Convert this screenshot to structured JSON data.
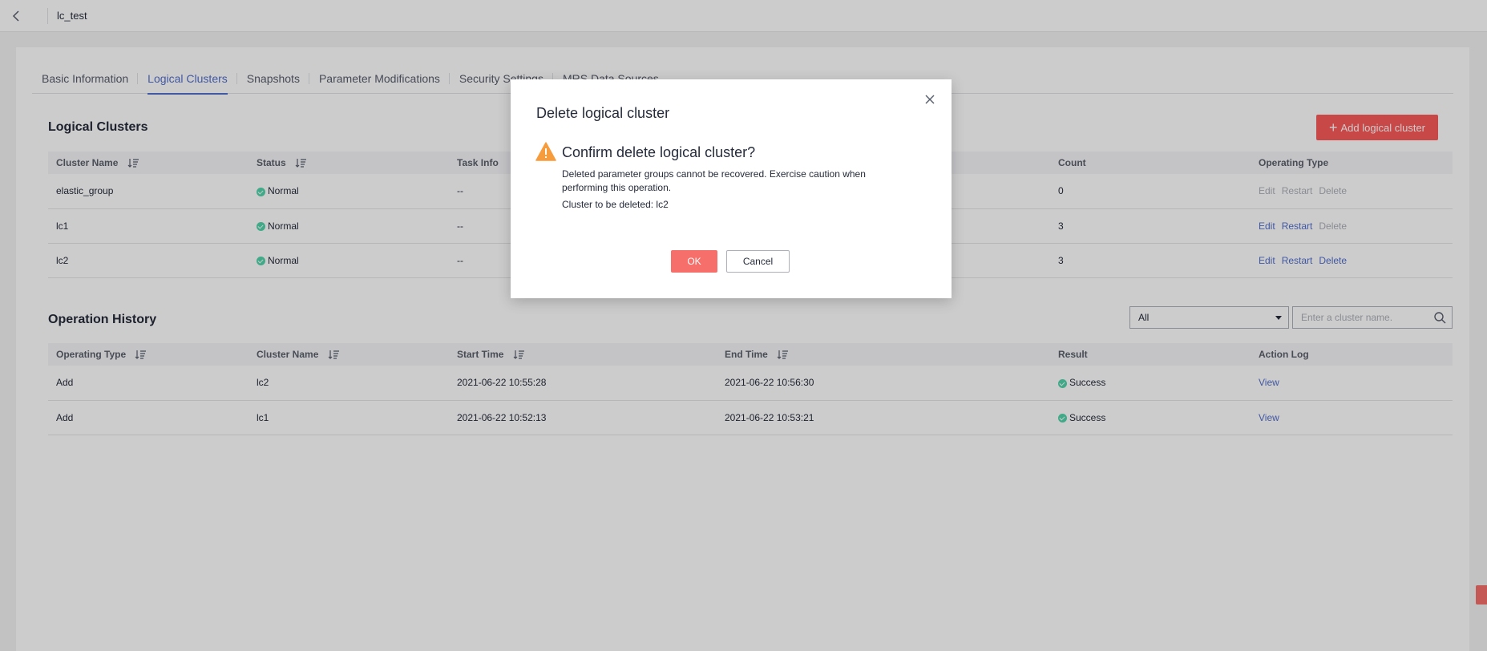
{
  "topbar": {
    "instance_name": "lc_test"
  },
  "tabs": [
    {
      "label": "Basic Information",
      "active": false
    },
    {
      "label": "Logical Clusters",
      "active": true
    },
    {
      "label": "Snapshots",
      "active": false
    },
    {
      "label": "Parameter Modifications",
      "active": false
    },
    {
      "label": "Security Settings",
      "active": false
    },
    {
      "label": "MRS Data Sources",
      "active": false
    }
  ],
  "logical_clusters": {
    "title": "Logical Clusters",
    "add_button_label": "Add logical cluster",
    "columns": [
      "Cluster Name",
      "Status",
      "Task Info",
      "Count",
      "Operating Type"
    ],
    "rows": [
      {
        "name": "elastic_group",
        "status": "Normal",
        "task_info": "--",
        "count": "0",
        "ops": [
          {
            "label": "Edit",
            "enabled": false
          },
          {
            "label": "Restart",
            "enabled": false
          },
          {
            "label": "Delete",
            "enabled": false
          }
        ]
      },
      {
        "name": "lc1",
        "status": "Normal",
        "task_info": "--",
        "count": "3",
        "ops": [
          {
            "label": "Edit",
            "enabled": true
          },
          {
            "label": "Restart",
            "enabled": true
          },
          {
            "label": "Delete",
            "enabled": false
          }
        ]
      },
      {
        "name": "lc2",
        "status": "Normal",
        "task_info": "--",
        "count": "3",
        "ops": [
          {
            "label": "Edit",
            "enabled": true
          },
          {
            "label": "Restart",
            "enabled": true
          },
          {
            "label": "Delete",
            "enabled": true
          }
        ]
      }
    ]
  },
  "operation_history": {
    "title": "Operation History",
    "filter_value": "All",
    "search_placeholder": "Enter a cluster name.",
    "columns": [
      "Operating Type",
      "Cluster Name",
      "Start Time",
      "End Time",
      "Result",
      "Action Log"
    ],
    "rows": [
      {
        "type": "Add",
        "cluster": "lc2",
        "start": "2021-06-22 10:55:28",
        "end": "2021-06-22 10:56:30",
        "result": "Success",
        "log": "View"
      },
      {
        "type": "Add",
        "cluster": "lc1",
        "start": "2021-06-22 10:52:13",
        "end": "2021-06-22 10:53:21",
        "result": "Success",
        "log": "View"
      }
    ]
  },
  "dialog": {
    "title": "Delete logical cluster",
    "heading": "Confirm delete logical cluster?",
    "description": "Deleted parameter groups cannot be recovered. Exercise caution when performing this operation.",
    "target": "Cluster to be deleted: lc2",
    "ok_label": "OK",
    "cancel_label": "Cancel"
  },
  "colors": {
    "accent": "#526ecc",
    "danger": "#fa5a5a",
    "success": "#50d4ab",
    "warning": "#f79c3d"
  }
}
